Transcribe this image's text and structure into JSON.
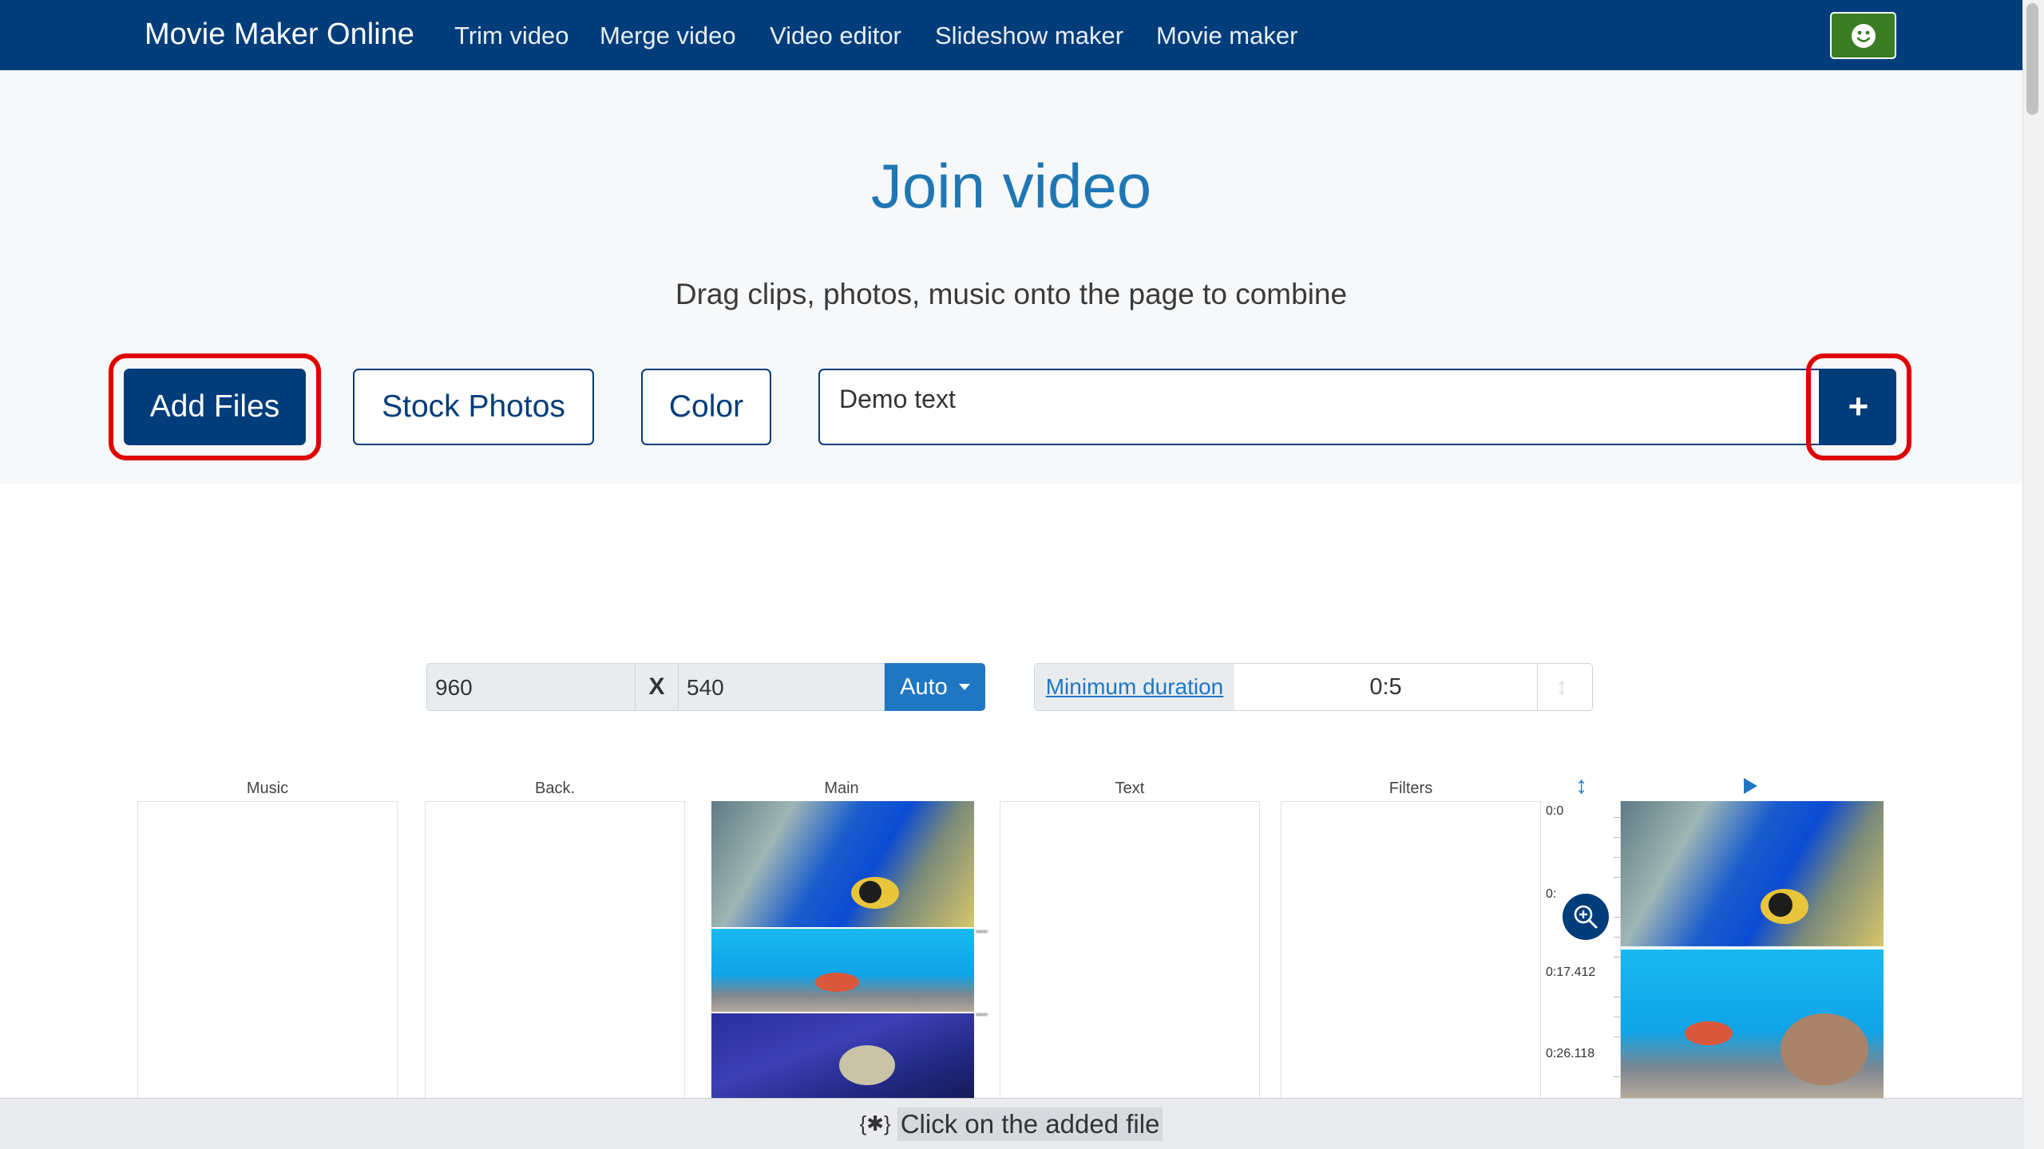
{
  "navbar": {
    "brand": "Movie Maker Online",
    "links": [
      "Trim video",
      "Merge video",
      "Video editor",
      "Slideshow maker",
      "Movie maker"
    ],
    "user_icon": "smiley-icon"
  },
  "hero": {
    "title": "Join video",
    "subtitle": "Drag clips, photos, music onto the page to combine",
    "add_files": "Add Files",
    "stock_photos": "Stock Photos",
    "color": "Color",
    "text_input_value": "Demo text",
    "add_text_button": "+"
  },
  "settings": {
    "width": "960",
    "x_label": "X",
    "height": "540",
    "auto_label": "Auto",
    "min_duration_label": "Minimum duration",
    "min_duration_value": "0:5"
  },
  "tracks": {
    "music": "Music",
    "back": "Back.",
    "main": "Main",
    "text": "Text",
    "filters": "Filters"
  },
  "timeline": {
    "times": [
      "0:0",
      "0:",
      "0:17.412",
      "0:26.118"
    ]
  },
  "bottom_hint": {
    "icon": "{✱}",
    "text": "Click on the added file"
  },
  "colors": {
    "navbar": "#003d7a",
    "accent": "#1f77c4",
    "highlight": "#e00000",
    "user_button": "#3b7d23"
  }
}
